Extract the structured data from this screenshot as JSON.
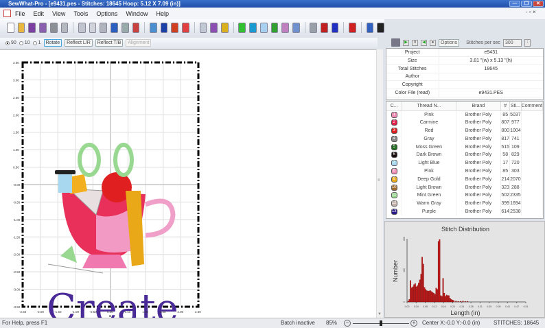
{
  "window": {
    "title": "SewWhat-Pro - [e9431.pes - Stitches: 18645  Hoop: 5.12 X 7.09 (in)]",
    "minimize": "—",
    "restore": "❐",
    "close": "✕"
  },
  "menu": [
    "File",
    "Edit",
    "View",
    "Tools",
    "Options",
    "Window",
    "Help"
  ],
  "toolbar_icons": [
    {
      "name": "new-file-icon",
      "color": "#ffffff"
    },
    {
      "name": "open-folder-icon",
      "color": "#e8b840"
    },
    {
      "name": "save-icon",
      "color": "#7a3fa0"
    },
    {
      "name": "save-as-icon",
      "color": "#8a5fb0"
    },
    {
      "name": "print-icon",
      "color": "#8b8f96"
    },
    {
      "name": "print-preview-icon",
      "color": "#b5b9c0"
    },
    {
      "sep": true
    },
    {
      "name": "cut-icon",
      "color": "#c0c4cc"
    },
    {
      "name": "copy-icon",
      "color": "#d0d4da"
    },
    {
      "name": "paste-icon",
      "color": "#b0b4bc"
    },
    {
      "name": "undo-icon",
      "color": "#2a5fbf"
    },
    {
      "name": "redo-icon",
      "color": "#9aa"
    },
    {
      "name": "grid-icon",
      "color": "#c84040"
    },
    {
      "sep": true
    },
    {
      "name": "convert-icon",
      "color": "#4a8fd0"
    },
    {
      "name": "b-icon",
      "color": "#1c3fa8"
    },
    {
      "name": "text-a-icon",
      "color": "#d04020"
    },
    {
      "name": "abc-icon",
      "color": "#e04040"
    },
    {
      "sep": true
    },
    {
      "name": "pages-icon",
      "color": "#c0c8d4"
    },
    {
      "name": "disk-icon",
      "color": "#8a4fb0"
    },
    {
      "name": "disk-yellow-icon",
      "color": "#d8b020"
    },
    {
      "sep": true
    },
    {
      "name": "green-block-icon",
      "color": "#30c030"
    },
    {
      "name": "shirt-icon",
      "color": "#1a9ad0"
    },
    {
      "name": "hoop-icon",
      "color": "#a8d0f0"
    },
    {
      "name": "gradient-icon",
      "color": "#30a030"
    },
    {
      "name": "palette-icon",
      "color": "#c080c0"
    },
    {
      "name": "needle-icon",
      "color": "#7090d0"
    },
    {
      "sep": true
    },
    {
      "name": "spools-icon",
      "color": "#9aa0a8"
    },
    {
      "name": "swap-colors-icon",
      "color": "#c02020"
    },
    {
      "name": "swap-colors-back-icon",
      "color": "#2030c0"
    },
    {
      "sep": true
    },
    {
      "name": "split-icon",
      "color": "#d02020"
    },
    {
      "sep": true
    },
    {
      "name": "help-shield-icon",
      "color": "#3060c0"
    },
    {
      "name": "context-help-icon",
      "color": "#222222"
    }
  ],
  "rotate_bar": {
    "options": [
      "90",
      "10",
      "1"
    ],
    "selected": "90",
    "rotate": "Rotate",
    "reflect_lr": "Reflect L/R",
    "reflect_tb": "Reflect T/B",
    "alignment": "Alignment"
  },
  "canvas": {
    "x_ticks": [
      "-2.50",
      "-2.00",
      "-1.50",
      "-1.00",
      "-0.50",
      "0.00",
      "0.50",
      "1.00",
      "1.50",
      "2.00",
      "2.50"
    ],
    "y_ticks": [
      "3.50",
      "3.00",
      "2.50",
      "2.00",
      "1.50",
      "1.00",
      "0.50",
      "-0.00",
      "-0.50",
      "-1.00",
      "-1.50",
      "-2.00",
      "-2.50",
      "-3.00",
      "-3.50"
    ],
    "design_text": "Create",
    "design_text_color": "#4a2a96"
  },
  "player": {
    "options": "Options",
    "stitches_per_sec_label": "Stitches per sec",
    "stitches_per_sec": "300"
  },
  "properties": [
    {
      "label": "Project",
      "value": "e9431"
    },
    {
      "label": "Size",
      "value": "3.81 \"(w) x 5.13 \"(h)"
    },
    {
      "label": "Total Stitches",
      "value": "18645"
    },
    {
      "label": "Author",
      "value": ""
    },
    {
      "label": "Copyright",
      "value": ""
    },
    {
      "label": "Color File (read)",
      "value": "e9431.PES"
    }
  ],
  "threads": {
    "headers": [
      "C...",
      "Thread N...",
      "Brand",
      "#",
      "Sti...",
      "Comment"
    ],
    "rows": [
      {
        "n": "1",
        "name": "Pink",
        "brand": "Brother Poly",
        "num": "85",
        "st": "5037",
        "color": "#f08cb4"
      },
      {
        "n": "2",
        "name": "Carmine",
        "brand": "Brother Poly",
        "num": "807",
        "st": "977",
        "color": "#e0204a"
      },
      {
        "n": "3",
        "name": "Red",
        "brand": "Brother Poly",
        "num": "800",
        "st": "1004",
        "color": "#e02020"
      },
      {
        "n": "4",
        "name": "Gray",
        "brand": "Brother Poly",
        "num": "817",
        "st": "741",
        "color": "#8a8a8a"
      },
      {
        "n": "5",
        "name": "Moss Green",
        "brand": "Brother Poly",
        "num": "515",
        "st": "109",
        "color": "#1e6a1e"
      },
      {
        "n": "6",
        "name": "Dark Brown",
        "brand": "Brother Poly",
        "num": "58",
        "st": "829",
        "color": "#1a1010"
      },
      {
        "n": "7",
        "name": "Light Blue",
        "brand": "Brother Poly",
        "num": "17",
        "st": "720",
        "color": "#a8d8f0"
      },
      {
        "n": "8",
        "name": "Pink",
        "brand": "Brother Poly",
        "num": "85",
        "st": "303",
        "color": "#f08cb4"
      },
      {
        "n": "9",
        "name": "Deep Gold",
        "brand": "Brother Poly",
        "num": "214",
        "st": "2070",
        "color": "#e8a818"
      },
      {
        "n": "10",
        "name": "Light Brown",
        "brand": "Brother Poly",
        "num": "323",
        "st": "288",
        "color": "#a06a30"
      },
      {
        "n": "11",
        "name": "Mint Green",
        "brand": "Brother Poly",
        "num": "502",
        "st": "2335",
        "color": "#98d890"
      },
      {
        "n": "12",
        "name": "Warm Gray",
        "brand": "Brother Poly",
        "num": "399",
        "st": "1694",
        "color": "#c0b0a8"
      },
      {
        "n": "13",
        "name": "Purple",
        "brand": "Brother Poly",
        "num": "614",
        "st": "2538",
        "color": "#2a1a8a"
      }
    ]
  },
  "chart_data": {
    "type": "bar",
    "title": "Stitch Distribution",
    "xlabel": "Length (in)",
    "ylabel": "Number",
    "xlim": [
      0,
      0.51
    ],
    "ylim": [
      0,
      200
    ],
    "x_tick_labels": [
      "0.00",
      "0.04",
      "0.08",
      "0.12",
      "0.16",
      "0.20",
      "0.24",
      "0.28",
      "0.31",
      "0.35",
      "0.39",
      "0.43",
      "0.47",
      "0.51"
    ],
    "y_tick_labels": [
      "0",
      "100",
      "200"
    ],
    "x": [
      0.005,
      0.01,
      0.015,
      0.02,
      0.025,
      0.03,
      0.035,
      0.04,
      0.045,
      0.05,
      0.055,
      0.06,
      0.065,
      0.07,
      0.075,
      0.08,
      0.085,
      0.09,
      0.095,
      0.1,
      0.105,
      0.11,
      0.115,
      0.12,
      0.125,
      0.13,
      0.135,
      0.14,
      0.145,
      0.15,
      0.155,
      0.16,
      0.165,
      0.17,
      0.175,
      0.18,
      0.185,
      0.19,
      0.195,
      0.2,
      0.21,
      0.22,
      0.23,
      0.24,
      0.25,
      0.26
    ],
    "values": [
      3,
      8,
      68,
      45,
      48,
      55,
      58,
      48,
      52,
      60,
      70,
      88,
      142,
      120,
      46,
      40,
      36,
      34,
      35,
      36,
      33,
      30,
      28,
      24,
      44,
      40,
      192,
      198,
      20,
      18,
      75,
      28,
      18,
      22,
      20,
      20,
      12,
      8,
      6,
      5,
      3,
      2,
      2,
      3,
      2,
      2
    ],
    "bar_color": "#c01818"
  },
  "status": {
    "help": "For Help, press F1",
    "batch": "Batch inactive",
    "zoom": "85%",
    "zoom_level": 0.5,
    "center": "Center X:-0.0  Y:-0.0 (in)",
    "stitches": "STITCHES: 18645"
  }
}
